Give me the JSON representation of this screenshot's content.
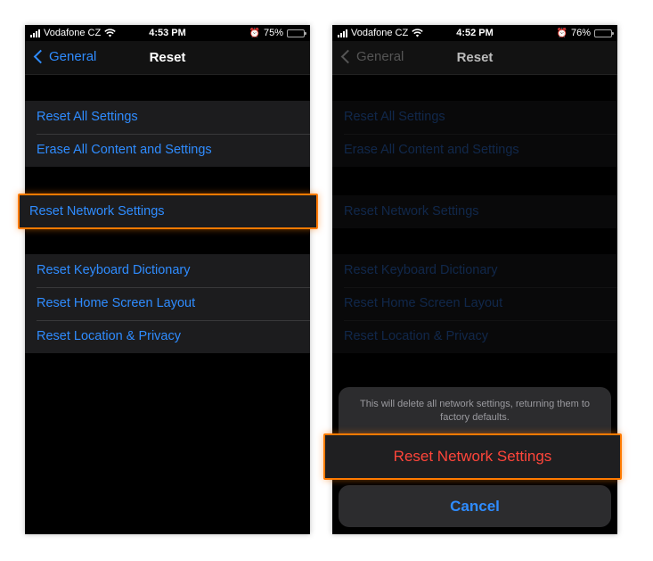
{
  "left_screen": {
    "status": {
      "carrier": "Vodafone CZ",
      "time": "4:53 PM",
      "battery": "75%",
      "battery_level": 0.75
    },
    "nav": {
      "back_label": "General",
      "title": "Reset"
    },
    "groups": [
      [
        "Reset All Settings",
        "Erase All Content and Settings"
      ],
      [
        "Reset Network Settings"
      ],
      [
        "Reset Keyboard Dictionary",
        "Reset Home Screen Layout",
        "Reset Location & Privacy"
      ]
    ]
  },
  "right_screen": {
    "status": {
      "carrier": "Vodafone CZ",
      "time": "4:52 PM",
      "battery": "76%",
      "battery_level": 0.76
    },
    "nav": {
      "back_label": "General",
      "title": "Reset"
    },
    "groups": [
      [
        "Reset All Settings",
        "Erase All Content and Settings"
      ],
      [
        "Reset Network Settings"
      ],
      [
        "Reset Keyboard Dictionary",
        "Reset Home Screen Layout",
        "Reset Location & Privacy"
      ]
    ],
    "action_sheet": {
      "message": "This will delete all network settings, returning them to factory defaults.",
      "confirm_label": "Reset Network Settings",
      "cancel_label": "Cancel"
    }
  },
  "colors": {
    "accent_blue": "#2f8cff",
    "destructive_red": "#ff453a",
    "highlight_orange": "#ff7a00"
  }
}
